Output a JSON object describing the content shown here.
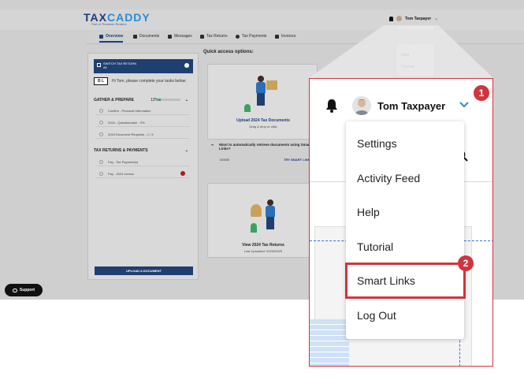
{
  "app": {
    "logo_main": "TAX",
    "logo_accent": "CADDY",
    "logo_sub": "Part of Thomson Reuters"
  },
  "nav": {
    "items": [
      {
        "label": "Overview"
      },
      {
        "label": "Documents"
      },
      {
        "label": "Messages"
      },
      {
        "label": "Tax Returns"
      },
      {
        "label": "Tax Payments"
      },
      {
        "label": "Invoices"
      }
    ]
  },
  "user": {
    "name": "Tom Taxpayer"
  },
  "menu": {
    "items": [
      {
        "label": "Settings"
      },
      {
        "label": "Activity Feed"
      },
      {
        "label": "Help"
      },
      {
        "label": "Tutorial"
      },
      {
        "label": "Smart Links"
      },
      {
        "label": "Log Out"
      }
    ]
  },
  "tasks_panel": {
    "switch_label": "SWITCH TAX RETURN",
    "switch_value": "All",
    "badge": "B L",
    "greeting": "Hi Tom, please complete your tasks below:",
    "gather_title": "GATHER & PREPARE",
    "gather_pct": "12%",
    "gather_progress": 0.12,
    "gather_tasks": [
      {
        "label": "Confirm - Personal Information"
      },
      {
        "label": "2024 - Questionnaire - 0%"
      },
      {
        "label": "2024 Document Requests - 1 / 5"
      }
    ],
    "returns_title": "TAX RETURNS & PAYMENTS",
    "returns_tasks": [
      {
        "label": "Pay - Tax Payment(s)"
      },
      {
        "label": "Pay - 2024 Invoice"
      }
    ],
    "upload_button": "UPLOAD A DOCUMENT"
  },
  "quick_access": {
    "title": "Quick access options:",
    "upload_title": "Upload 2024 Tax Documents",
    "upload_sub": "Drag & drop or click",
    "auto_text": "Want to automatically retrieve documents using Smart Links?",
    "auto_left": "0/0000",
    "auto_right": "TRY SMART LINKS",
    "view_title": "View 2024 Tax Returns",
    "view_sub": "Last Uploaded: 02/05/2025"
  },
  "support": {
    "label": "Support"
  },
  "callouts": {
    "one": "1",
    "two": "2"
  },
  "colors": {
    "brand_navy": "#1f3f70",
    "brand_blue": "#2a8bd6",
    "callout_red": "#d1343f"
  }
}
